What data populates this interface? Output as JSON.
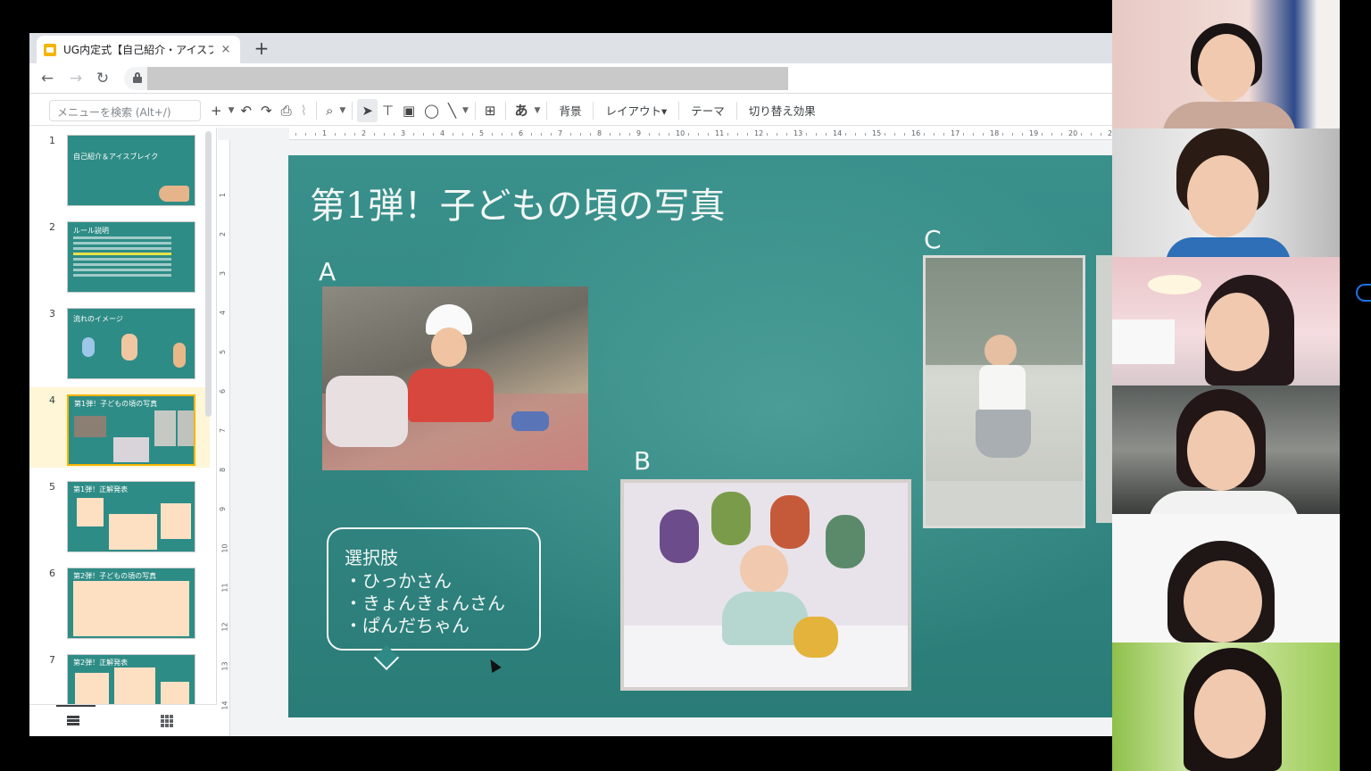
{
  "browser": {
    "tab_title": "UG内定式【自己紹介・アイスブレイク",
    "tab_close": "×",
    "new_tab": "+"
  },
  "toolbar": {
    "search_placeholder": "メニューを検索 (Alt+/)",
    "background_label": "背景",
    "layout_label": "レイアウト▾",
    "theme_label": "テーマ",
    "transition_label": "切り替え効果",
    "text_style_label": "あ"
  },
  "filmstrip": {
    "slides": [
      {
        "number": "1",
        "text": "自己紹介＆アイスブレイク"
      },
      {
        "number": "2",
        "text": "ルール説明"
      },
      {
        "number": "3",
        "text": "流れのイメージ"
      },
      {
        "number": "4",
        "text": "第1弾！子どもの頃の写真"
      },
      {
        "number": "5",
        "text": "第1弾！正解発表"
      },
      {
        "number": "6",
        "text": "第2弾！子どもの頃の写真"
      },
      {
        "number": "7",
        "text": "第2弾！正解発表"
      }
    ]
  },
  "ruler": {
    "top": [
      "1",
      "2",
      "3",
      "4",
      "5",
      "6",
      "7",
      "8",
      "9",
      "10",
      "11",
      "12",
      "13",
      "14",
      "15",
      "16",
      "17",
      "18",
      "19",
      "20",
      "2"
    ],
    "left": [
      "1",
      "2",
      "3",
      "4",
      "5",
      "6",
      "7",
      "8",
      "9",
      "10",
      "11",
      "12",
      "13",
      "14"
    ]
  },
  "slide": {
    "title": "第1弾！子どもの頃の写真",
    "label_a": "A",
    "label_b": "B",
    "label_c": "C",
    "choices_title": "選択肢",
    "choices": [
      "・ひっかさん",
      "・きょんきょんさん",
      "・ぱんだちゃん"
    ]
  },
  "colors": {
    "slide_bg": "#2f8a85",
    "accent_yellow": "#f4b400",
    "selected_row": "#fef6d6"
  },
  "icons": [
    "back-icon",
    "forward-icon",
    "reload-icon",
    "lock-icon",
    "plus-icon",
    "undo-icon",
    "redo-icon",
    "print-icon",
    "paint-format-icon",
    "zoom-icon",
    "select-icon",
    "textbox-icon",
    "image-icon",
    "shape-icon",
    "line-icon",
    "comment-icon",
    "list-view-icon",
    "grid-view-icon"
  ]
}
